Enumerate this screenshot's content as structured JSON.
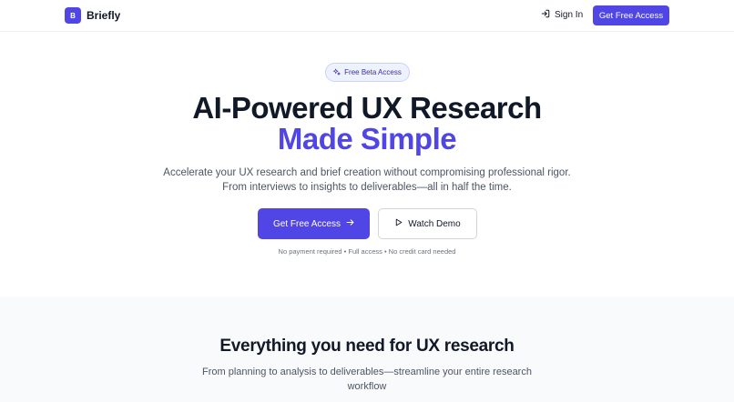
{
  "header": {
    "logo_letter": "B",
    "logo_text": "Briefly",
    "signin_label": "Sign In",
    "cta_label": "Get Free Access"
  },
  "hero": {
    "badge_label": "Free Beta Access",
    "title": "AI-Powered UX Research",
    "title_accent": "Made Simple",
    "subtitle_line1": "Accelerate your UX research and brief creation without compromising professional rigor.",
    "subtitle_line2": "From interviews to insights to deliverables—all in half the time.",
    "primary_button": "Get Free Access",
    "secondary_button": "Watch Demo",
    "note": "No payment required • Full access • No credit card needed"
  },
  "features": {
    "title": "Everything you need for UX research",
    "subtitle_line1": "From planning to analysis to deliverables—streamline your entire research",
    "subtitle_line2": "workflow"
  },
  "icons": {
    "signin": "sign-in-arrow",
    "badge": "sparkles",
    "primary_button": "arrow-right",
    "secondary_button": "play"
  },
  "colors": {
    "brand": "#4f46e5",
    "text": "#111827",
    "muted": "#4b5563",
    "section_bg": "#f9fafb"
  }
}
